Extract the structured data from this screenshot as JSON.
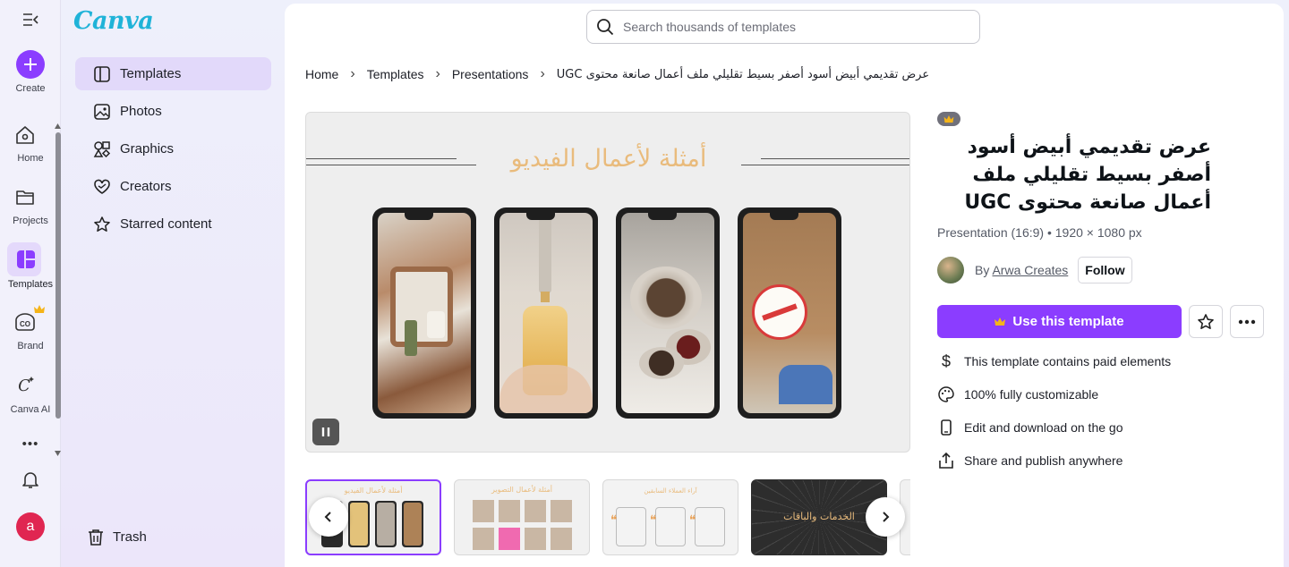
{
  "rail": {
    "create_label": "Create",
    "items": [
      {
        "label": "Home",
        "icon": "home-icon"
      },
      {
        "label": "Projects",
        "icon": "folder-icon"
      },
      {
        "label": "Templates",
        "icon": "templates-icon"
      },
      {
        "label": "Brand",
        "icon": "brand-icon"
      },
      {
        "label": "Canva AI",
        "icon": "canva-ai-icon"
      }
    ],
    "more_label": "•••",
    "avatar_letter": "a"
  },
  "side": {
    "logo": "Canva",
    "nav": [
      {
        "label": "Templates",
        "icon": "templates-icon"
      },
      {
        "label": "Photos",
        "icon": "photos-icon"
      },
      {
        "label": "Graphics",
        "icon": "graphics-icon"
      },
      {
        "label": "Creators",
        "icon": "creators-icon"
      },
      {
        "label": "Starred content",
        "icon": "star-icon"
      }
    ],
    "trash_label": "Trash"
  },
  "search": {
    "placeholder": "Search thousands of templates"
  },
  "breadcrumb": [
    "Home",
    "Templates",
    "Presentations",
    "عرض تقديمي أبيض أسود أصفر بسيط تقليلي ملف أعمال صانعة محتوى UGC"
  ],
  "preview": {
    "slide_title": "أمثلة لأعمال الفيديو"
  },
  "thumbnails": [
    {
      "caption": "أمثلة لأعمال الفيديو"
    },
    {
      "caption": "أمثلة لأعمال التصوير"
    },
    {
      "caption": "آراء العملاء السابقين"
    },
    {
      "caption": "الخدمات والباقات"
    }
  ],
  "details": {
    "title": "عرض تقديمي أبيض أسود أصفر بسيط تقليلي ملف أعمال صانعة محتوى UGC",
    "meta": "Presentation (16:9) • 1920 × 1080 px",
    "by_prefix": "By",
    "author": "Arwa Creates",
    "follow_label": "Follow",
    "use_label": "Use this template",
    "features": [
      {
        "label": "This template contains paid elements",
        "icon": "dollar-icon"
      },
      {
        "label": "100% fully customizable",
        "icon": "palette-icon"
      },
      {
        "label": "Edit and download on the go",
        "icon": "mobile-icon"
      },
      {
        "label": "Share and publish anywhere",
        "icon": "share-icon"
      }
    ]
  },
  "colors": {
    "accent": "#8b3dff",
    "logo": "#1fb3d8",
    "slide_title": "#e9bb7c"
  }
}
